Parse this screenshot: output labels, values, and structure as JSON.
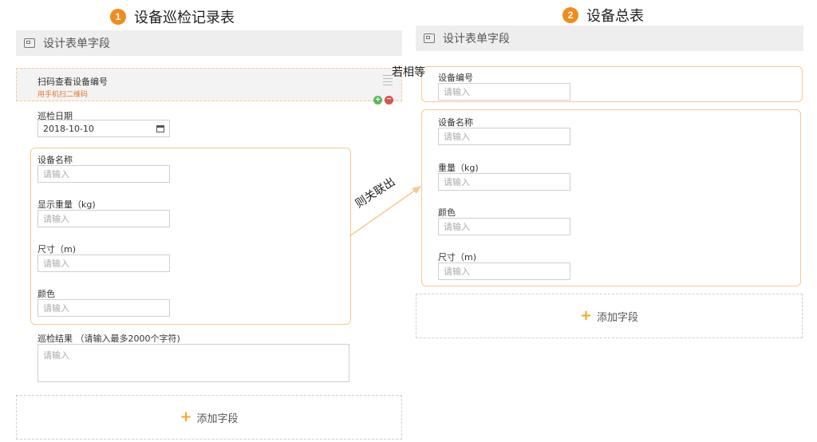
{
  "left": {
    "step_number": "1",
    "step_title": "设备巡检记录表",
    "panel_title": "设计表单字段",
    "scan_field": {
      "label": "扫码查看设备编号",
      "hint": "用手机扫二维码"
    },
    "date_field": {
      "label": "巡检日期",
      "value": "2018-10-10"
    },
    "linked_fields": [
      {
        "label": "设备名称",
        "placeholder": "请输入"
      },
      {
        "label": "显示重量（kg)",
        "placeholder": "请输入"
      },
      {
        "label": "尺寸（m)",
        "placeholder": "请输入"
      },
      {
        "label": "颜色",
        "placeholder": "请输入"
      }
    ],
    "result_field": {
      "label": "巡检结果 （请输入最多2000个字符)",
      "placeholder": "请输入"
    },
    "add_field_label": "添加字段"
  },
  "right": {
    "step_number": "2",
    "step_title": "设备总表",
    "panel_title": "设计表单字段",
    "code_field": {
      "label": "设备编号",
      "placeholder": "请输入"
    },
    "fields": [
      {
        "label": "设备名称",
        "placeholder": "请输入"
      },
      {
        "label": "重量（kg)",
        "placeholder": "请输入"
      },
      {
        "label": "颜色",
        "placeholder": "请输入"
      },
      {
        "label": "尺寸（m)",
        "placeholder": "请输入"
      }
    ],
    "add_field_label": "添加字段"
  },
  "annotations": {
    "equal_text": "若相等",
    "linked_text": "则关联出"
  },
  "colors": {
    "accent_orange": "#f08c1e",
    "highlight_border": "#f8c892",
    "panel_header_bg": "#eeeeee"
  }
}
